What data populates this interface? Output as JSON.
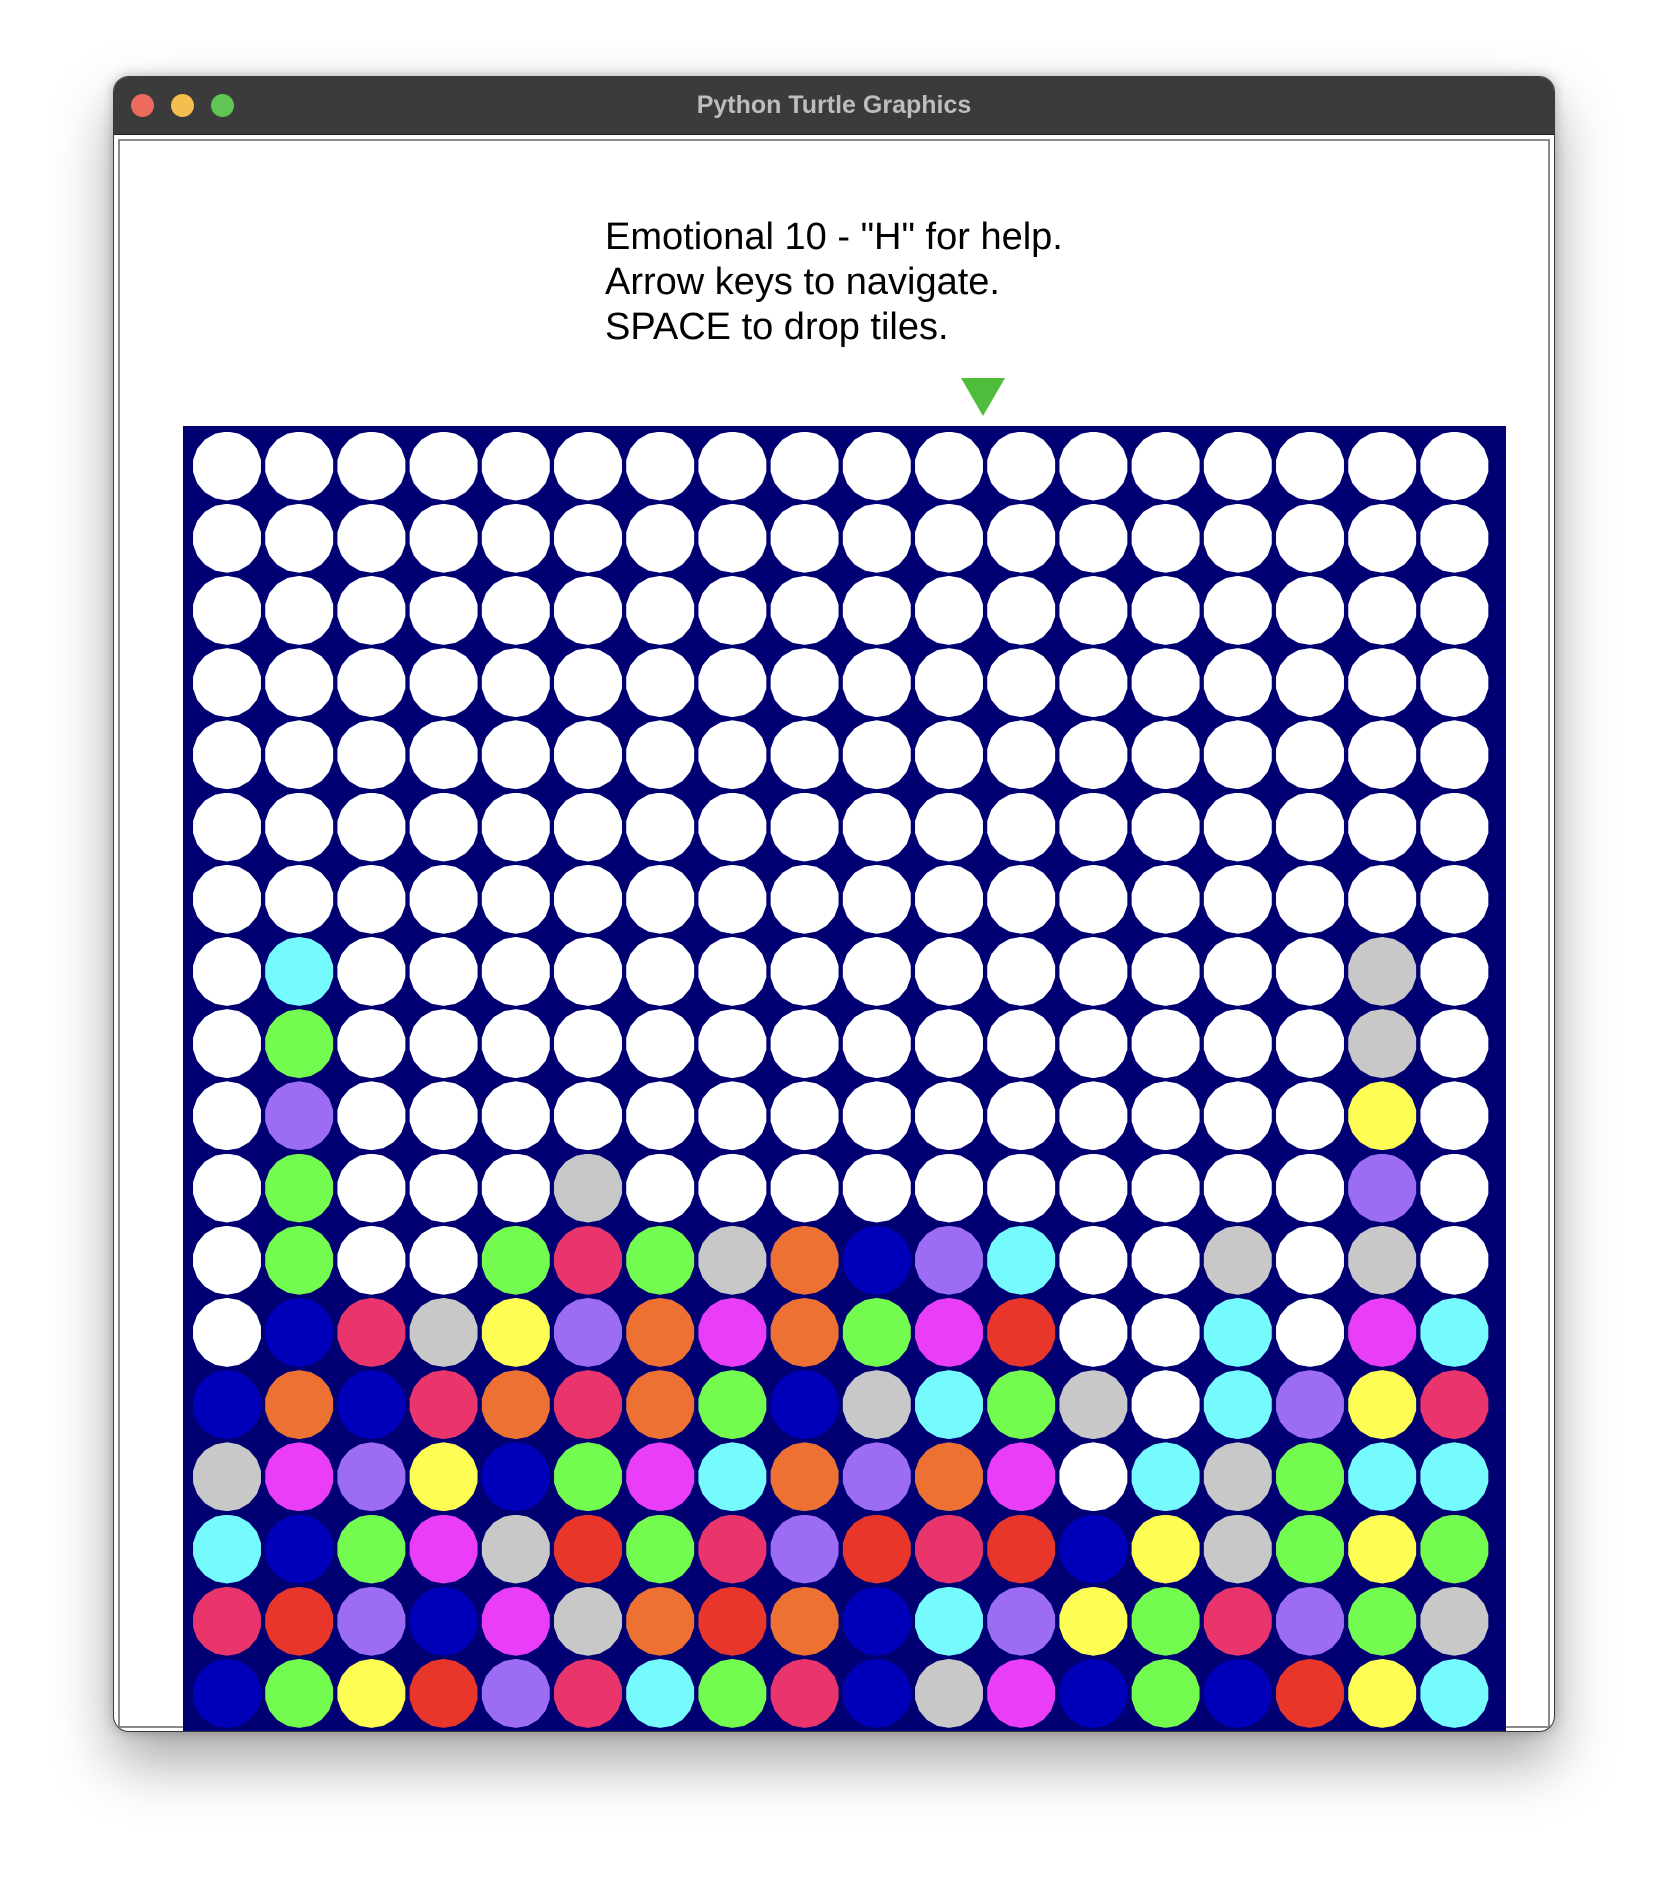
{
  "window": {
    "title": "Python Turtle Graphics"
  },
  "status_text": {
    "line1": "Emotional 10 - \"H\" for help.",
    "line2": "Arrow keys to navigate.",
    "line3": "SPACE to drop tiles."
  },
  "cursor": {
    "icon": "down-triangle-cursor-icon",
    "column": 11,
    "color": "#4fbd3c"
  },
  "palette": {
    "W": "#ffffff",
    "c": "#75fbfd",
    "g": "#74fb4f",
    "p": "#9d6cf4",
    "s": "#c8c8c8",
    "r": "#e9356b",
    "o": "#ec7132",
    "b": "#0000bb",
    "y": "#fefd54",
    "m": "#ea3df7",
    "R": "#e8362a"
  },
  "board": {
    "background": "#000072",
    "rows": [
      "WWWWWWWWWWWWWWWWWW",
      "WWWWWWWWWWWWWWWWWW",
      "WWWWWWWWWWWWWWWWWW",
      "WWWWWWWWWWWWWWWWWW",
      "WWWWWWWWWWWWWWWWWW",
      "WWWWWWWWWWWWWWWWWW",
      "WWWWWWWWWWWWWWWWWW",
      "WcWWWWWWWWWWWWWWsW",
      "WgWWWWWWWWWWWWWWsW",
      "WpWWWWWWWWWWWWWWyW",
      "WgWWWsWWWWWWWWWWpW",
      "WgWWgrgsobpcWWsWsW",
      "WbrsyvomogmRWWcWmc",
      "bobrorogbscgsWcpyr",
      "smpybgmcopomWcsgcc",
      "cbgmsRgrpRrRbysgyg",
      "rRpbmsoRobcpygrpgs",
      "bgyRprcgrbsmbgbRyc"
    ]
  }
}
